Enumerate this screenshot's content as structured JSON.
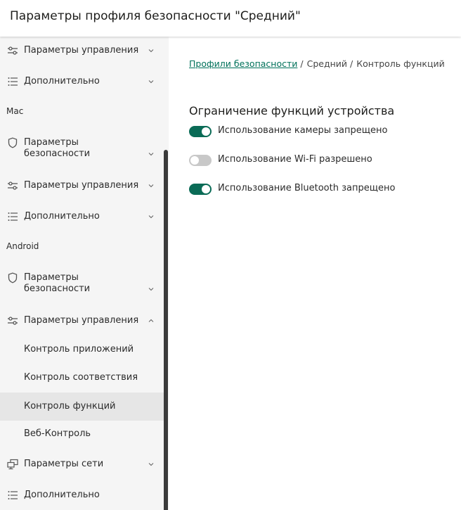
{
  "header": {
    "title": "Параметры профиля безопасности \"Средний\""
  },
  "sidebar": {
    "items": [
      {
        "label": "Параметры управления"
      },
      {
        "label": "Дополнительно"
      },
      {
        "section": "Mac"
      },
      {
        "label": "Параметры безопасности"
      },
      {
        "label": "Параметры управления"
      },
      {
        "label": "Дополнительно"
      },
      {
        "section": "Android"
      },
      {
        "label": "Параметры безопасности"
      },
      {
        "label": "Параметры управления",
        "expanded": true
      },
      {
        "label": "Контроль приложений"
      },
      {
        "label": "Контроль соответствия"
      },
      {
        "label": "Контроль функций",
        "active": true
      },
      {
        "label": "Веб-Контроль"
      },
      {
        "label": "Параметры сети"
      },
      {
        "label": "Дополнительно"
      }
    ],
    "security_label_line1": "Параметры",
    "security_label_line2": "безопасности"
  },
  "breadcrumb": {
    "root": "Профили безопасности",
    "profile": "Средний",
    "current": "Контроль функций",
    "separator": "/"
  },
  "main": {
    "section_title": "Ограничение функций устройства",
    "toggles": [
      {
        "label": "Использование камеры запрещено",
        "on": true
      },
      {
        "label": "Использование Wi-Fi разрешено",
        "on": false
      },
      {
        "label": "Использование Bluetooth запрещено",
        "on": true
      }
    ]
  },
  "colors": {
    "accent": "#0a6b56",
    "link": "#00715a",
    "sidebar_bg": "#f5f5f5",
    "active_bg": "#e6e6e6"
  }
}
